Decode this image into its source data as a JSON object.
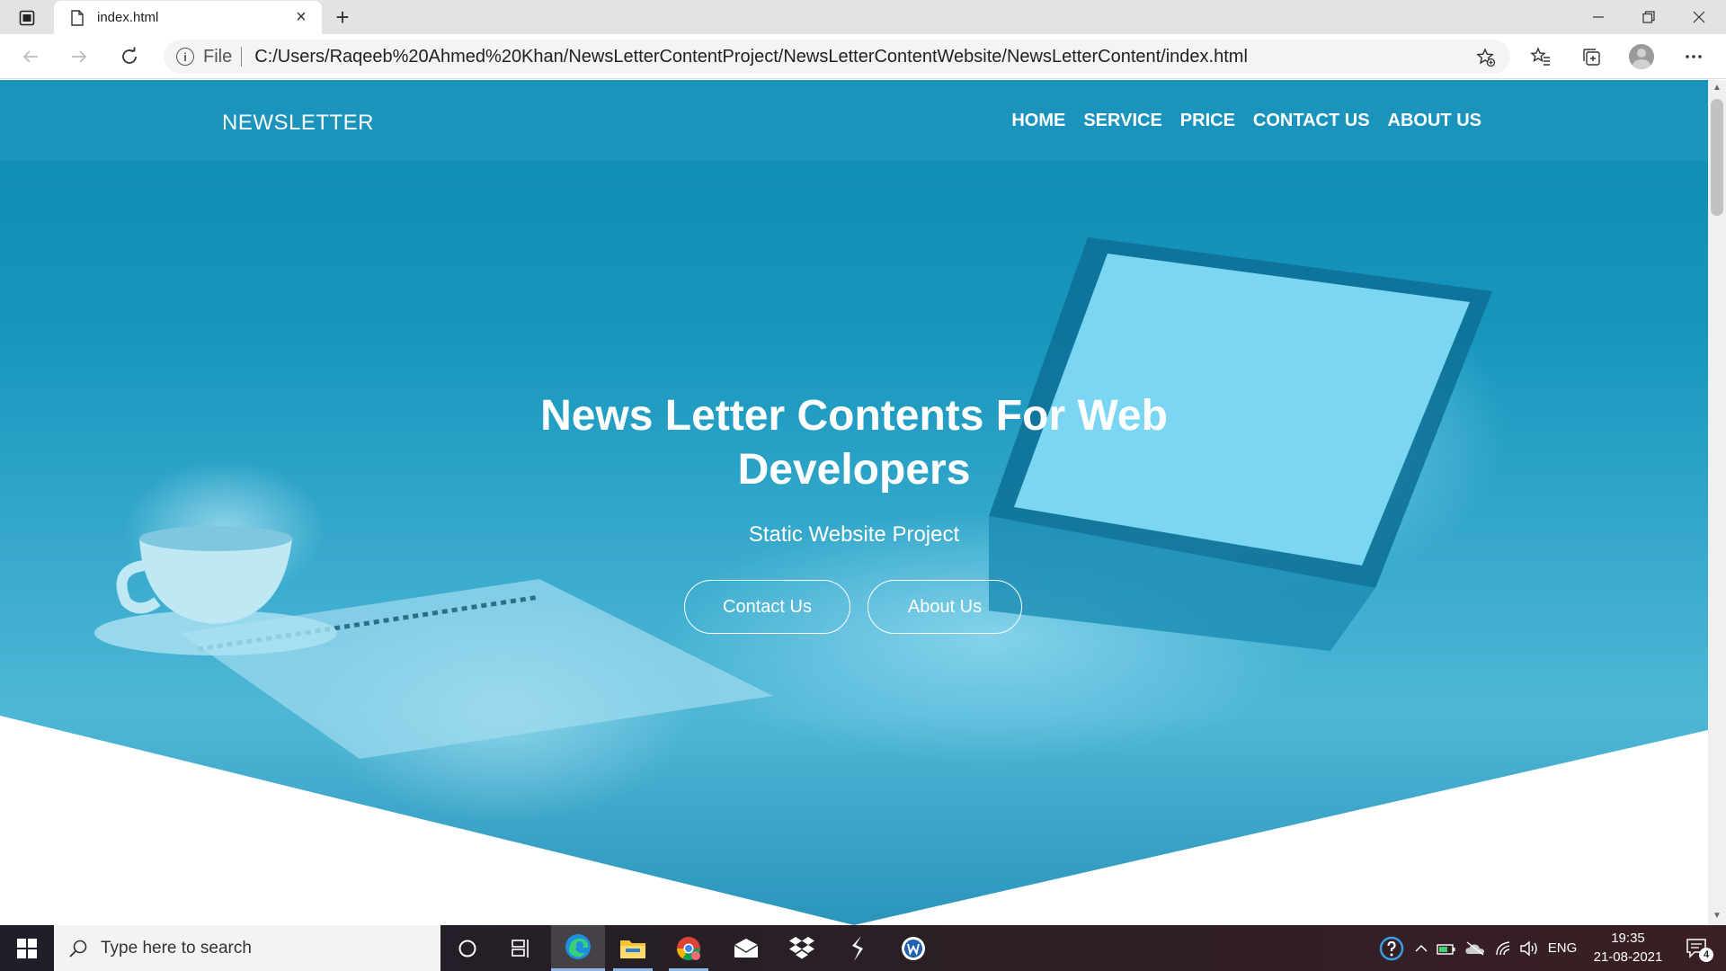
{
  "browser": {
    "tab_title": "index.html",
    "new_tab_symbol": "+",
    "close_tab_symbol": "×",
    "address_prefix": "File",
    "url": "C:/Users/Raqeeb%20Ahmed%20Khan/NewsLetterContentProject/NewsLetterContentWebsite/NewsLetterContent/index.html",
    "info_symbol": "i"
  },
  "site": {
    "brand": "NEWSLETTER",
    "nav": [
      {
        "label": "HOME"
      },
      {
        "label": "SERVICE"
      },
      {
        "label": "PRICE"
      },
      {
        "label": "CONTACT US"
      },
      {
        "label": "ABOUT US"
      }
    ],
    "hero": {
      "title": "News Letter Contents For Web Developers",
      "subtitle": "Static Website Project",
      "primary_button": "Contact Us",
      "secondary_button": "About Us"
    },
    "accent_color": "#1796bd"
  },
  "taskbar": {
    "search_placeholder": "Type here to search",
    "language": "ENG",
    "time": "19:35",
    "date": "21-08-2021",
    "notification_count": "4"
  }
}
